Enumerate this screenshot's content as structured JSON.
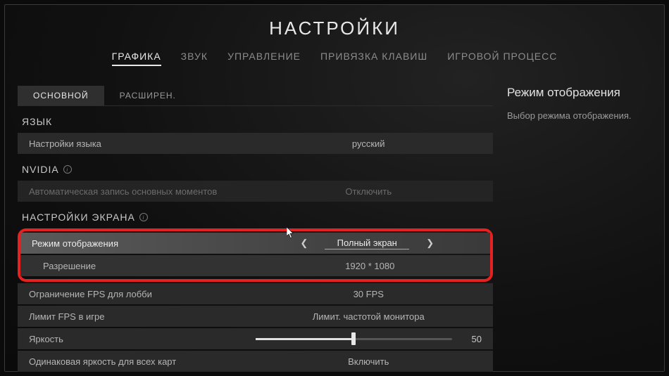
{
  "title": "НАСТРОЙКИ",
  "mainTabs": [
    "ГРАФИКА",
    "ЗВУК",
    "УПРАВЛЕНИЕ",
    "ПРИВЯЗКА КЛАВИШ",
    "ИГРОВОЙ ПРОЦЕСС"
  ],
  "subTabs": [
    "ОСНОВНОЙ",
    "РАСШИРЕН."
  ],
  "sections": {
    "language": "ЯЗЫК",
    "nvidia": "NVIDIA",
    "display": "НАСТРОЙКИ ЭКРАНА"
  },
  "rows": {
    "language": {
      "label": "Настройки языка",
      "value": "русский"
    },
    "nvidia": {
      "label": "Автоматическая запись основных моментов",
      "value": "Отключить"
    },
    "displayMode": {
      "label": "Режим отображения",
      "value": "Полный экран"
    },
    "resolution": {
      "label": "Разрешение",
      "value": "1920 * 1080"
    },
    "lobbyFps": {
      "label": "Ограничение FPS для лобби",
      "value": "30 FPS"
    },
    "ingameFps": {
      "label": "Лимит FPS в игре",
      "value": "Лимит. частотой монитора"
    },
    "brightness": {
      "label": "Яркость",
      "value": "50"
    },
    "sameBrightness": {
      "label": "Одинаковая яркость для всех карт",
      "value": "Включить"
    }
  },
  "description": {
    "title": "Режим отображения",
    "text": "Выбор режима отображения."
  }
}
